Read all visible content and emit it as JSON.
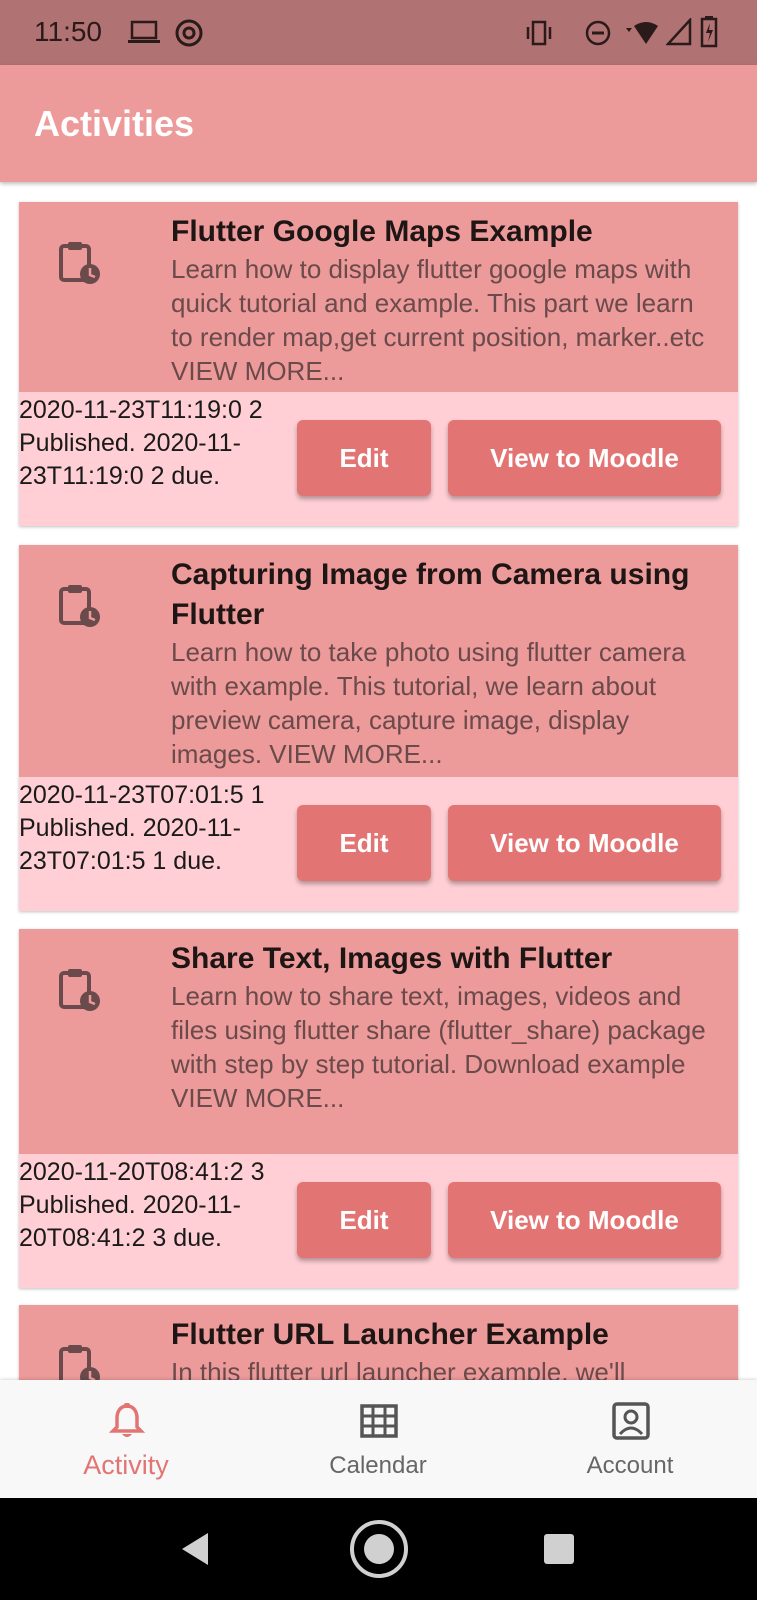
{
  "status_bar": {
    "time": "11:50"
  },
  "app_bar": {
    "title": "Activities"
  },
  "activities": [
    {
      "title": "Flutter Google Maps Example",
      "description": "Learn how to display flutter google maps with quick tutorial and example. This part we learn to render map,get current position, marker..etc VIEW MORE...",
      "dates": "2020-11-23T11:19:0 2 Published. 2020-11-23T11:19:0 2 due.",
      "edit_label": "Edit",
      "moodle_label": "View to Moodle"
    },
    {
      "title": "Capturing Image from Camera using Flutter",
      "description": "Learn how to take photo using flutter camera with example. This tutorial, we learn about preview camera, capture image, display images. VIEW MORE...",
      "dates": "2020-11-23T07:01:5 1 Published. 2020-11-23T07:01:5 1 due.",
      "edit_label": "Edit",
      "moodle_label": "View to Moodle"
    },
    {
      "title": "Share Text, Images with Flutter",
      "description": "Learn how to share text, images, videos and files using flutter share (flutter_share) package with step by step tutorial. Download example VIEW MORE...",
      "dates": "2020-11-20T08:41:2 3 Published. 2020-11-20T08:41:2 3 due.",
      "edit_label": "Edit",
      "moodle_label": "View to Moodle"
    },
    {
      "title": "Flutter URL Launcher Example",
      "description": "In this flutter url launcher example, we'll"
    }
  ],
  "bottom_nav": {
    "items": [
      {
        "label": "Activity",
        "icon": "bell-icon",
        "active": true
      },
      {
        "label": "Calendar",
        "icon": "calendar-grid-icon",
        "active": false
      },
      {
        "label": "Account",
        "icon": "account-box-icon",
        "active": false
      }
    ]
  },
  "colors": {
    "status_bar": "#b07272",
    "app_bar": "#ed9a9a",
    "card_top": "#ed9a9a",
    "card_bottom": "#ffcfd5",
    "button": "#e37474",
    "nav_active": "#e37474"
  }
}
